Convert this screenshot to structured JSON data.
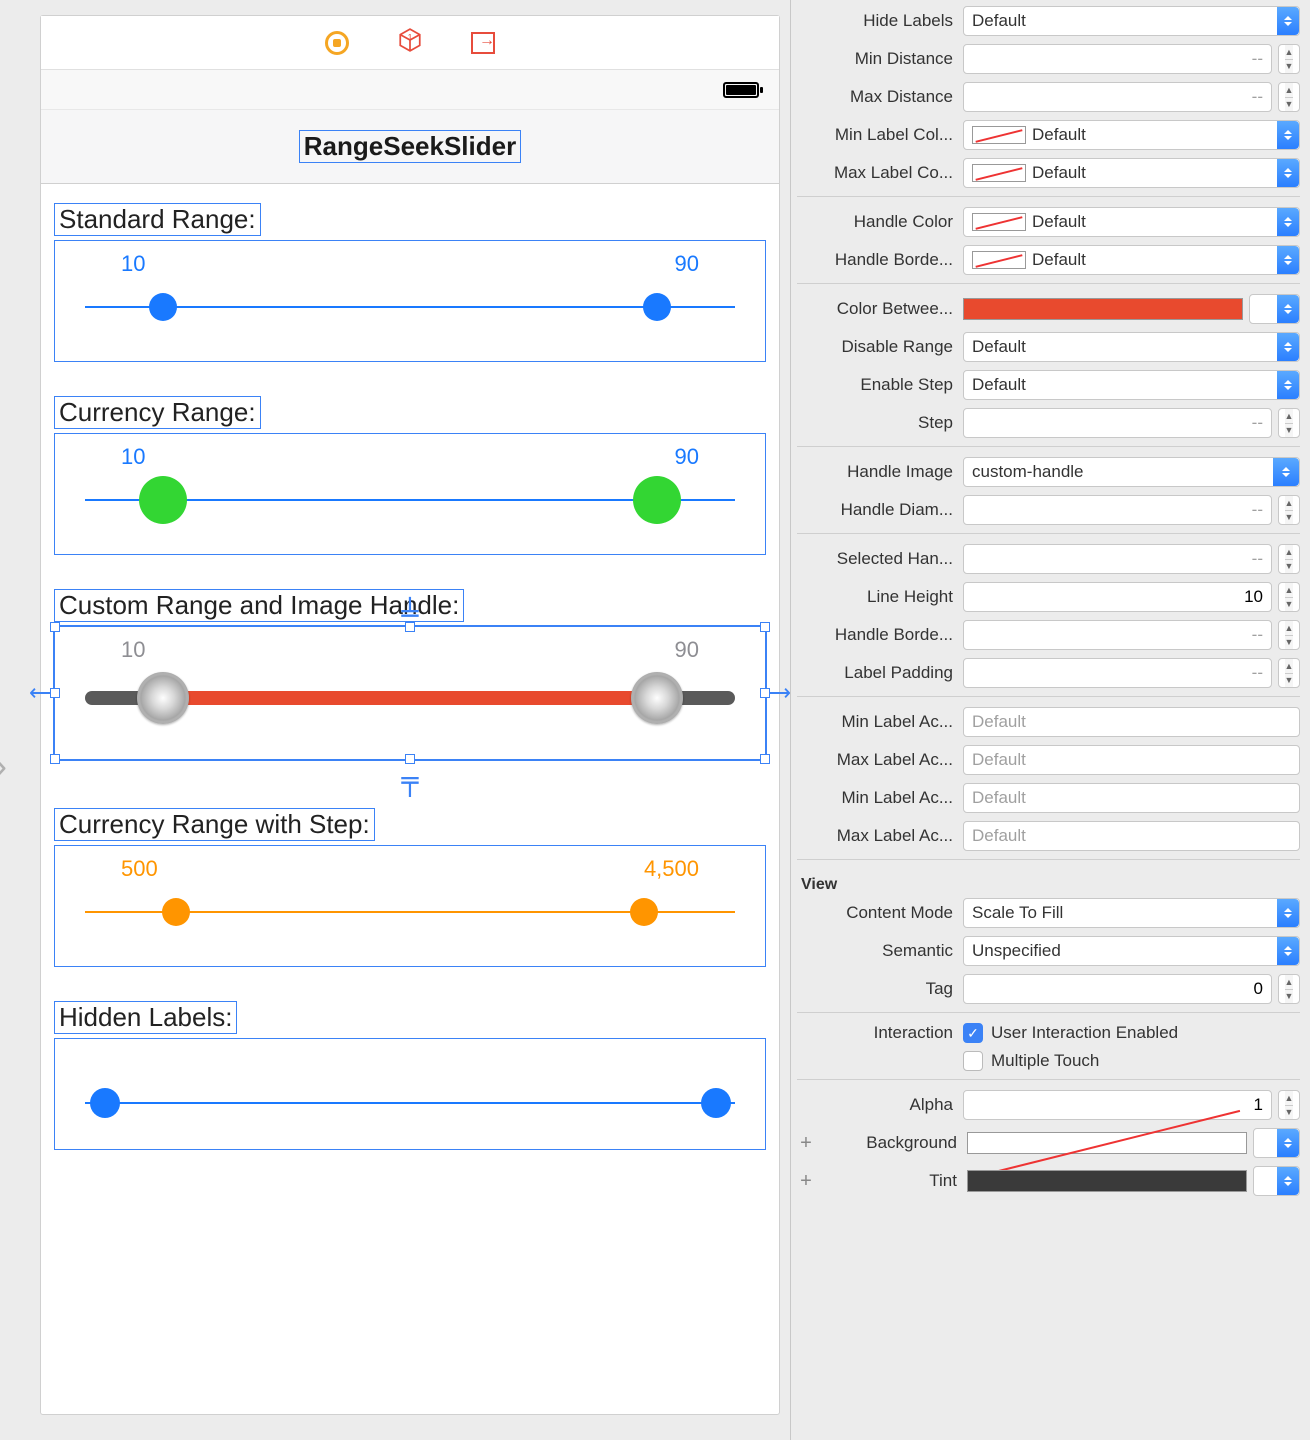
{
  "canvas": {
    "toolbar_icons": [
      "stop-icon",
      "cube-icon",
      "exit-icon"
    ],
    "nav_title": "RangeSeekSlider",
    "sections": {
      "standard": {
        "label": "Standard Range:",
        "min": "10",
        "max": "90"
      },
      "currency": {
        "label": "Currency Range:",
        "min": "10",
        "max": "90"
      },
      "custom": {
        "label": "Custom Range and Image Handle:",
        "min": "10",
        "max": "90"
      },
      "step": {
        "label": "Currency Range with Step:",
        "min": "500",
        "max": "4,500"
      },
      "hidden": {
        "label": "Hidden Labels:"
      }
    }
  },
  "inspector": {
    "hide_labels": "Default",
    "min_distance": "--",
    "max_distance": "--",
    "min_label_color": "Default",
    "max_label_color": "Default",
    "handle_color": "Default",
    "handle_border_color": "Default",
    "disable_range": "Default",
    "enable_step": "Default",
    "step": "--",
    "handle_image": "custom-handle",
    "handle_diameter": "--",
    "selected_handle": "--",
    "line_height": "10",
    "handle_border_width": "--",
    "label_padding": "--",
    "min_label_acc": "Default",
    "max_label_acc": "Default",
    "min_label_acc2": "Default",
    "max_label_acc2": "Default",
    "view_header": "View",
    "content_mode": "Scale To Fill",
    "semantic": "Unspecified",
    "tag": "0",
    "interaction_label": "Interaction",
    "user_interaction": "User Interaction Enabled",
    "multiple_touch": "Multiple Touch",
    "alpha": "1",
    "background_label": "Background",
    "tint_label": "Tint"
  },
  "labels": {
    "hide_labels": "Hide Labels",
    "min_distance": "Min Distance",
    "max_distance": "Max Distance",
    "min_label_color": "Min Label Col...",
    "max_label_color": "Max Label Co...",
    "handle_color": "Handle Color",
    "handle_border_color": "Handle Borde...",
    "color_between": "Color Betwee...",
    "disable_range": "Disable Range",
    "enable_step": "Enable Step",
    "step": "Step",
    "handle_image": "Handle Image",
    "handle_diameter": "Handle Diam...",
    "selected_handle": "Selected Han...",
    "line_height": "Line Height",
    "handle_border_width": "Handle Borde...",
    "label_padding": "Label Padding",
    "min_label_acc": "Min Label Ac...",
    "max_label_acc": "Max Label Ac...",
    "content_mode": "Content Mode",
    "semantic": "Semantic",
    "tag": "Tag",
    "alpha": "Alpha"
  }
}
